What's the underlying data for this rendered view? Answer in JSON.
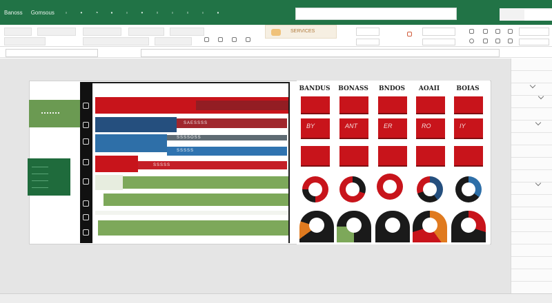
{
  "ribbon_tabs": [
    "Banoss",
    "Gomsous",
    "",
    "",
    "",
    "",
    "",
    "",
    "",
    "",
    "",
    "",
    ""
  ],
  "ribbon_highlight_label": "SERVICES",
  "chart": {
    "column_headers": [
      "BANDUS",
      "BONASS",
      "BNDOS",
      "AOAII",
      "BOIAS"
    ],
    "tile_labels": [
      "BY",
      "ANT",
      "ER",
      "RO",
      "IY"
    ],
    "bar_labels": [
      "SAESSSS",
      "SSSSOSS",
      "SSSSS",
      "SSSSS"
    ],
    "left_tab_label": "~~~"
  },
  "colors": {
    "excel_green": "#217346",
    "red": "#c8141b",
    "blue": "#2e6fa8",
    "green": "#7da85a"
  }
}
